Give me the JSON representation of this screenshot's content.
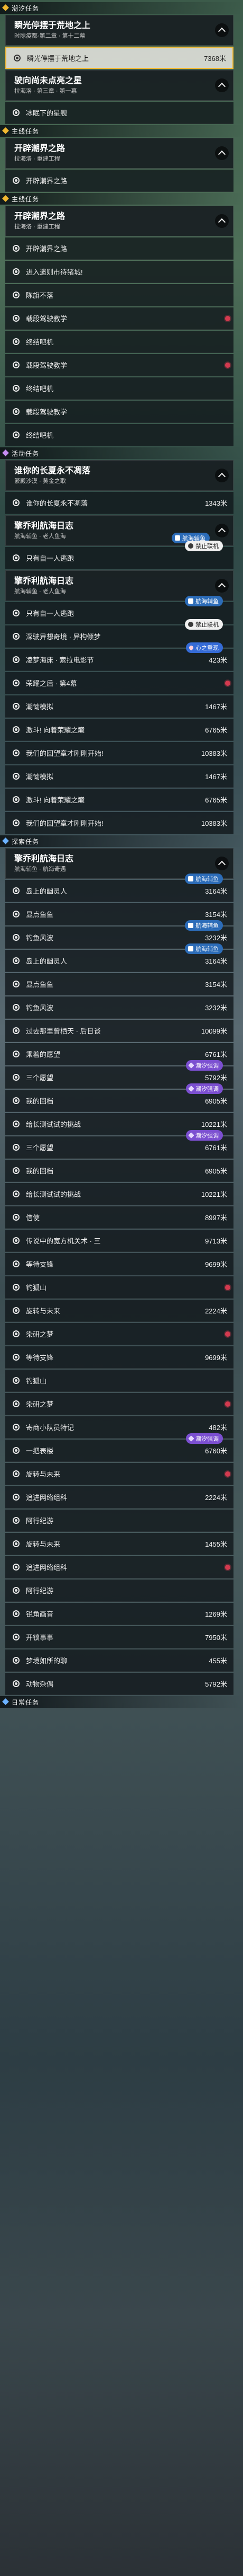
{
  "colors": {
    "main_quest": "#f0b730",
    "event_quest": "#c68df2",
    "daily_quest": "#6cb2ff",
    "tracked_border": "#f0b730",
    "waypoint_pin": "#d33a4f"
  },
  "rows": [
    {
      "kind": "section",
      "label": "潮汐任务",
      "icon": "diamond"
    },
    {
      "kind": "header",
      "title": "瞬光停摆于荒地之上",
      "subtitle": "时隙疫都·第二章 · 第十二幕"
    },
    {
      "kind": "quest",
      "label": "瞬光停摆于荒地之上",
      "distance": "7368米",
      "highlight": true
    },
    {
      "kind": "header",
      "title": "驶向尚未点亮之星",
      "subtitle": "拉海洛 · 第三章 · 第一幕"
    },
    {
      "kind": "quest",
      "label": "冰眠下的星舰"
    },
    {
      "kind": "section",
      "label": "主线任务",
      "icon": "diamond"
    },
    {
      "kind": "header",
      "title": "开辟潮界之路",
      "subtitle": "拉海洛 · 重建工程"
    },
    {
      "kind": "quest",
      "label": "开辟潮界之路"
    },
    {
      "kind": "section",
      "label": "主线任务",
      "icon": "diamond"
    },
    {
      "kind": "header",
      "title": "开辟潮界之路",
      "subtitle": "拉海洛 · 重建工程"
    },
    {
      "kind": "quest",
      "label": "开辟潮界之路"
    },
    {
      "kind": "quest",
      "label": "进入遗则市待猪城!"
    },
    {
      "kind": "quest",
      "label": "陈旗不落"
    },
    {
      "kind": "quest",
      "label": "载段驾驶教学",
      "pin": true
    },
    {
      "kind": "quest",
      "label": "终结吧机"
    },
    {
      "kind": "quest",
      "label": "载段驾驶教学",
      "pin": true
    },
    {
      "kind": "quest",
      "label": "终结吧机"
    },
    {
      "kind": "quest",
      "label": "载段驾驶教学"
    },
    {
      "kind": "quest",
      "label": "终结吧机"
    },
    {
      "kind": "section",
      "label": "活动任务",
      "icon": "diamond-purple"
    },
    {
      "kind": "header",
      "title": "谁你的长夏永不凋落",
      "subtitle": "繁殿沙漠 · 黄金之歌"
    },
    {
      "kind": "quest",
      "label": "谁你的长夏永不凋落",
      "distance": "1343米"
    },
    {
      "kind": "header",
      "title": "擎乔利航海日志",
      "subtitle": "航海辅鱼 · 老人鱼海",
      "badge": "航海辅鱼",
      "badge_type": "track"
    },
    {
      "kind": "quest",
      "label": "只有自一人逃跑",
      "badge": "禁止联机",
      "badge_type": "ban"
    },
    {
      "kind": "header",
      "title": "擎乔利航海日志",
      "subtitle": "航海辅鱼 · 老人鱼海"
    },
    {
      "kind": "quest",
      "label": "只有自一人逃跑",
      "badge": "航海辅鱼",
      "badge_type": "track"
    },
    {
      "kind": "quest",
      "label": "深驶异想奇境 · 异构倾梦",
      "badge": "禁止联机",
      "badge_type": "ban"
    },
    {
      "kind": "quest",
      "label": "凌梦海床 · 索拉电影节",
      "distance": "423米",
      "badge": "心之重现",
      "badge_type": "heart"
    },
    {
      "kind": "quest",
      "label": "荣耀之后 · 第4幕",
      "pin": true
    },
    {
      "kind": "quest",
      "label": "潮恸模拟",
      "distance": "1467米"
    },
    {
      "kind": "quest",
      "label": "激斗! 向着荣耀之巅",
      "distance": "6765米"
    },
    {
      "kind": "quest",
      "label": "我们的回望章才刚刚开始!",
      "distance": "10383米"
    },
    {
      "kind": "quest",
      "label": "潮恸模拟",
      "distance": "1467米"
    },
    {
      "kind": "quest",
      "label": "激斗! 向着荣耀之巅",
      "distance": "6765米"
    },
    {
      "kind": "quest",
      "label": "我们的回望章才刚刚开始!",
      "distance": "10383米"
    },
    {
      "kind": "section",
      "label": "探索任务",
      "icon": "diamond-blue"
    },
    {
      "kind": "header",
      "title": "擎乔利航海日志",
      "subtitle": "航海辅鱼 · 航海奇遇"
    },
    {
      "kind": "quest",
      "label": "岛上的幽灵人",
      "distance": "3164米",
      "badge": "航海辅鱼",
      "badge_type": "track"
    },
    {
      "kind": "quest",
      "label": "显点鱼鱼",
      "distance": "3154米"
    },
    {
      "kind": "quest",
      "label": "钓鱼风波",
      "distance": "3232米",
      "badge": "航海辅鱼",
      "badge_type": "track"
    },
    {
      "kind": "quest",
      "label": "岛上的幽灵人",
      "distance": "3164米",
      "badge": "航海辅鱼",
      "badge_type": "track"
    },
    {
      "kind": "quest",
      "label": "显点鱼鱼",
      "distance": "3154米"
    },
    {
      "kind": "quest",
      "label": "钓鱼风波",
      "distance": "3232米"
    },
    {
      "kind": "quest",
      "label": "过去那里曾栖天 · 后日谈",
      "distance": "10099米"
    },
    {
      "kind": "quest",
      "label": "乘着的愿望",
      "distance": "6761米"
    },
    {
      "kind": "quest",
      "label": "三个愿望",
      "distance": "5792米",
      "badge": "潮汐强调",
      "badge_type": "tide"
    },
    {
      "kind": "quest",
      "label": "我的回档",
      "distance": "6905米",
      "badge": "潮汐强调",
      "badge_type": "tide"
    },
    {
      "kind": "quest",
      "label": "给长测试试的挑战",
      "distance": "10221米"
    },
    {
      "kind": "quest",
      "label": "三个愿望",
      "distance": "6761米",
      "badge": "潮汐强调",
      "badge_type": "tide"
    },
    {
      "kind": "quest",
      "label": "我的回档",
      "distance": "6905米"
    },
    {
      "kind": "quest",
      "label": "给长测试试的挑战",
      "distance": "10221米"
    },
    {
      "kind": "quest",
      "label": "信使",
      "distance": "8997米"
    },
    {
      "kind": "quest",
      "label": "传说中的宽方机关术 · 三",
      "distance": "9713米"
    },
    {
      "kind": "quest",
      "label": "等待支锋",
      "distance": "9699米"
    },
    {
      "kind": "quest",
      "label": "钓狐山",
      "pin": true
    },
    {
      "kind": "quest",
      "label": "旋转与未来",
      "distance": "2224米"
    },
    {
      "kind": "quest",
      "label": "染研之梦",
      "pin": true
    },
    {
      "kind": "quest",
      "label": "等待支锋",
      "distance": "9699米"
    },
    {
      "kind": "quest",
      "label": "钓狐山"
    },
    {
      "kind": "quest",
      "label": "染研之梦",
      "pin": true
    },
    {
      "kind": "quest",
      "label": "寄商小队员特记",
      "distance": "482米"
    },
    {
      "kind": "quest",
      "label": "一把表楼",
      "distance": "6760米",
      "badge": "潮汐强调",
      "badge_type": "tide"
    },
    {
      "kind": "quest",
      "label": "旋转与未来",
      "pin": true
    },
    {
      "kind": "quest",
      "label": "追进网络组科",
      "distance": "2224米"
    },
    {
      "kind": "quest",
      "label": "阿行纪游"
    },
    {
      "kind": "quest",
      "label": "旋转与未来",
      "distance": "1455米"
    },
    {
      "kind": "quest",
      "label": "追进网络组科",
      "pin": true
    },
    {
      "kind": "quest",
      "label": "阿行纪游"
    },
    {
      "kind": "quest",
      "label": "锐角画音",
      "distance": "1269米"
    },
    {
      "kind": "quest",
      "label": "开锁事事",
      "distance": "7950米"
    },
    {
      "kind": "quest",
      "label": "梦境如所的聊",
      "distance": "455米"
    },
    {
      "kind": "quest",
      "label": "动物杂偶",
      "distance": "5792米"
    },
    {
      "kind": "section",
      "label": "日常任务",
      "icon": "diamond-blue"
    }
  ]
}
